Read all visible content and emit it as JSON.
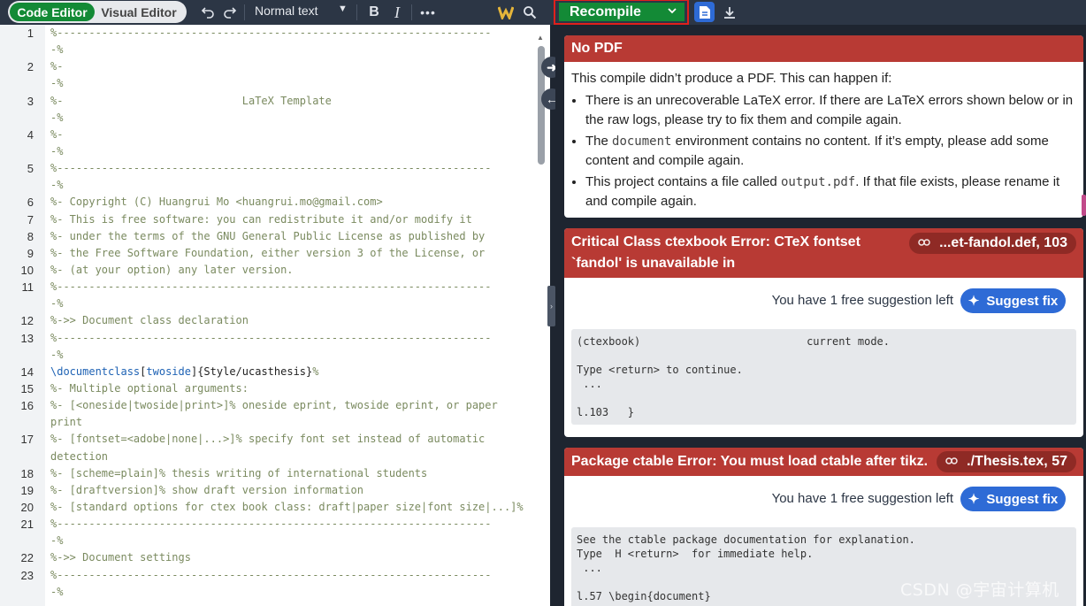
{
  "toolbar": {
    "code_editor": "Code Editor",
    "visual_editor": "Visual Editor",
    "text_style": "Normal text",
    "recompile": "Recompile"
  },
  "editor": {
    "lines": [
      {
        "n": "1",
        "text": "%--------------------------------------------------------------------",
        "kind": "comment"
      },
      {
        "n": "",
        "text": "-%",
        "kind": "comment"
      },
      {
        "n": "2",
        "text": "%-",
        "kind": "comment"
      },
      {
        "n": "",
        "text": "-%",
        "kind": "comment"
      },
      {
        "n": "3",
        "text": "%-                            LaTeX Template",
        "kind": "comment"
      },
      {
        "n": "",
        "text": "-%",
        "kind": "comment"
      },
      {
        "n": "4",
        "text": "%-",
        "kind": "comment"
      },
      {
        "n": "",
        "text": "-%",
        "kind": "comment"
      },
      {
        "n": "5",
        "text": "%--------------------------------------------------------------------",
        "kind": "comment"
      },
      {
        "n": "",
        "text": "-%",
        "kind": "comment"
      },
      {
        "n": "6",
        "text": "%- Copyright (C) Huangrui Mo <huangrui.mo@gmail.com>",
        "kind": "comment"
      },
      {
        "n": "7",
        "text": "%- This is free software: you can redistribute it and/or modify it",
        "kind": "comment"
      },
      {
        "n": "8",
        "text": "%- under the terms of the GNU General Public License as published by",
        "kind": "comment"
      },
      {
        "n": "9",
        "text": "%- the Free Software Foundation, either version 3 of the License, or",
        "kind": "comment"
      },
      {
        "n": "10",
        "text": "%- (at your option) any later version.",
        "kind": "comment"
      },
      {
        "n": "11",
        "text": "%--------------------------------------------------------------------",
        "kind": "comment"
      },
      {
        "n": "",
        "text": "-%",
        "kind": "comment"
      },
      {
        "n": "12",
        "text": "%->> Document class declaration",
        "kind": "comment"
      },
      {
        "n": "13",
        "text": "%--------------------------------------------------------------------",
        "kind": "comment"
      },
      {
        "n": "",
        "text": "-%",
        "kind": "comment"
      },
      {
        "n": "14",
        "text": "\\documentclass[twoside]{Style/ucasthesis}%",
        "kind": "command"
      },
      {
        "n": "15",
        "text": "%- Multiple optional arguments:",
        "kind": "comment"
      },
      {
        "n": "16",
        "text": "%- [<oneside|twoside|print>]% oneside eprint, twoside eprint, or paper",
        "kind": "comment"
      },
      {
        "n": "",
        "text": "print",
        "kind": "comment"
      },
      {
        "n": "17",
        "text": "%- [fontset=<adobe|none|...>]% specify font set instead of automatic",
        "kind": "comment"
      },
      {
        "n": "",
        "text": "detection",
        "kind": "comment"
      },
      {
        "n": "18",
        "text": "%- [scheme=plain]% thesis writing of international students",
        "kind": "comment"
      },
      {
        "n": "19",
        "text": "%- [draftversion]% show draft version information",
        "kind": "comment"
      },
      {
        "n": "20",
        "text": "%- [standard options for ctex book class: draft|paper size|font size|...]%",
        "kind": "comment"
      },
      {
        "n": "21",
        "text": "%--------------------------------------------------------------------",
        "kind": "comment"
      },
      {
        "n": "",
        "text": "-%",
        "kind": "comment"
      },
      {
        "n": "22",
        "text": "%->> Document settings",
        "kind": "comment"
      },
      {
        "n": "23",
        "text": "%--------------------------------------------------------------------",
        "kind": "comment"
      },
      {
        "n": "",
        "text": "-%",
        "kind": "comment"
      }
    ]
  },
  "logs": {
    "no_pdf": {
      "title": "No PDF",
      "intro": "This compile didn’t produce a PDF. This can happen if:",
      "b1": "There is an unrecoverable LaTeX error. If there are LaTeX errors shown below or in the raw logs, please try to fix them and compile again.",
      "b2_pre": "The ",
      "b2_code": "document",
      "b2_post": " environment contains no content. If it’s empty, please add some content and compile again.",
      "b3_pre": "This project contains a file called ",
      "b3_code": "output.pdf",
      "b3_post": ". If that file exists, please rename it and compile again."
    },
    "error1": {
      "title": "Critical Class ctexbook Error: CTeX fontset `fandol' is unavailable in",
      "location": "...et-fandol.def, 103",
      "suggestion_text": "You have 1 free suggestion left",
      "suggest_label": "Suggest fix",
      "raw": "(ctexbook)                          current mode.\n\nType <return> to continue.\n ...\n\nl.103   }"
    },
    "error2": {
      "title": "Package ctable Error: You must load ctable after tikz.",
      "location": "./Thesis.tex, 57",
      "suggestion_text": "You have 1 free suggestion left",
      "suggest_label": "Suggest fix",
      "raw": "See the ctable package documentation for explanation.\nType  H <return>  for immediate help.\n ...\n\nl.57 \\begin{document}"
    }
  },
  "watermark": "CSDN @宇宙计算机",
  "colors": {
    "accent_green": "#138a36",
    "error_red": "#b83a34",
    "primary_blue": "#2e6bd6",
    "toolbar_bg": "#2c3645"
  }
}
